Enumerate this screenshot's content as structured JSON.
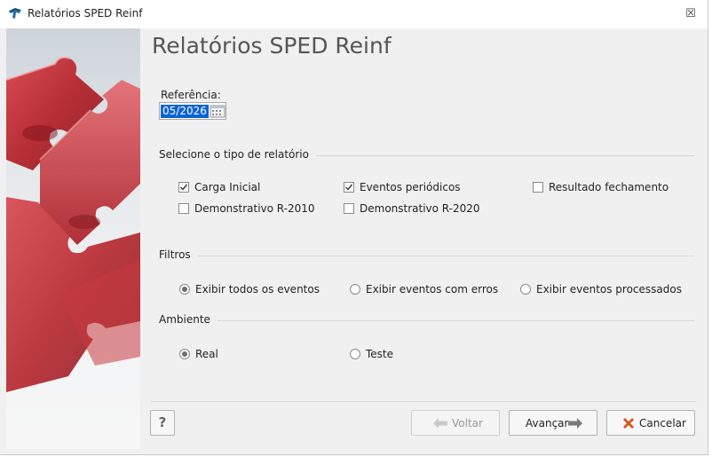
{
  "window": {
    "title": "Relatórios SPED Reinf",
    "close_symbol": "☒"
  },
  "header": {
    "title": "Relatórios SPED Reinf"
  },
  "referencia": {
    "label": "Referência:",
    "value": "05/2026"
  },
  "tipo_relatorio": {
    "title": "Selecione o tipo de relatório",
    "options": [
      {
        "label": "Carga Inicial",
        "checked": true
      },
      {
        "label": "Eventos periódicos",
        "checked": true
      },
      {
        "label": "Resultado fechamento",
        "checked": false
      },
      {
        "label": "Demonstrativo R-2010",
        "checked": false
      },
      {
        "label": "Demonstrativo R-2020",
        "checked": false
      }
    ]
  },
  "filtros": {
    "title": "Filtros",
    "options": [
      {
        "label": "Exibir todos os eventos",
        "selected": true
      },
      {
        "label": "Exibir eventos com erros",
        "selected": false
      },
      {
        "label": "Exibir eventos processados",
        "selected": false
      }
    ]
  },
  "ambiente": {
    "title": "Ambiente",
    "options": [
      {
        "label": "Real",
        "selected": true
      },
      {
        "label": "Teste",
        "selected": false
      }
    ]
  },
  "footer": {
    "help_label": "?",
    "back_label": "Voltar",
    "next_label": "Avançar",
    "cancel_label": "Cancelar"
  },
  "colors": {
    "accent": "#0a63d6",
    "puzzle": "#b5252c",
    "cancel_icon": "#d9541e",
    "arrow": "#7a7a7a"
  }
}
